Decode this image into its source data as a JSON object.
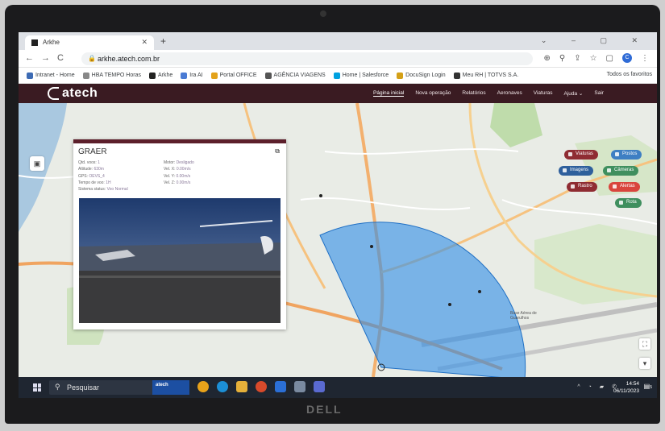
{
  "browser": {
    "tab_title": "Arkhe",
    "url": "arkhe.atech.com.br",
    "bookmarks": [
      "Intranet - Home",
      "HBA TEMPO Horas",
      "Arkhe",
      "Ira AI",
      "Portal OFFICE",
      "AGÊNCIA VIAGENS",
      "Home | Salesforce",
      "DocuSign Login",
      "Meu RH | TOTVS S.A."
    ],
    "bookmarks_end": "Todos os favoritos",
    "bookmark_colors": [
      "#3d6bb4",
      "#888888",
      "#222222",
      "#4a7bd4",
      "#e3a21a",
      "#555555",
      "#00a1e0",
      "#d4a017",
      "#333333"
    ]
  },
  "app": {
    "logo_text": "atech",
    "nav": [
      "Página inicial",
      "Nova operação",
      "Relatórios",
      "Aeronaves",
      "Viaturas",
      "Ajuda ⌄",
      "Sair"
    ],
    "colors": {
      "header": "#3a1b22",
      "coverage": "#2f8ee8"
    }
  },
  "map_buttons": [
    {
      "label": "Viaturas",
      "color": "#8f2c32"
    },
    {
      "label": "Postos",
      "color": "#3e7fc3"
    },
    {
      "label": "Imagens",
      "color": "#2e5f9c"
    },
    {
      "label": "Câmeras",
      "color": "#3f8f5e"
    },
    {
      "label": "Rastro",
      "color": "#8f2c32"
    },
    {
      "label": "Alertas",
      "color": "#d9453d"
    },
    {
      "label": "Rota",
      "color": "#3f8f5e"
    }
  ],
  "map_labels": {
    "airport": "Base Aérea de Guarulhos"
  },
  "popup": {
    "title": "GRAER",
    "left_fields": [
      {
        "label": "Qtd. voos:",
        "value": "1"
      },
      {
        "label": "Altitude:",
        "value": "630m"
      },
      {
        "label": "GPS:",
        "value": "OEVS_4"
      },
      {
        "label": "Tempo de voo:",
        "value": "1H"
      },
      {
        "label": "Sistema status:",
        "value": "Voo Normal"
      }
    ],
    "right_fields": [
      {
        "label": "Motor:",
        "value": "Desligado"
      },
      {
        "label": "Vel. X:",
        "value": "0.00m/s"
      },
      {
        "label": "Vel. Y:",
        "value": "0.00m/s"
      },
      {
        "label": "Vel. Z:",
        "value": "0.00m/s"
      }
    ]
  },
  "taskbar": {
    "search_placeholder": "Pesquisar",
    "atech_label": "atech",
    "time": "14:54",
    "date": "06/11/2023",
    "notifications": "5"
  },
  "hardware": {
    "brand": "DELL"
  }
}
